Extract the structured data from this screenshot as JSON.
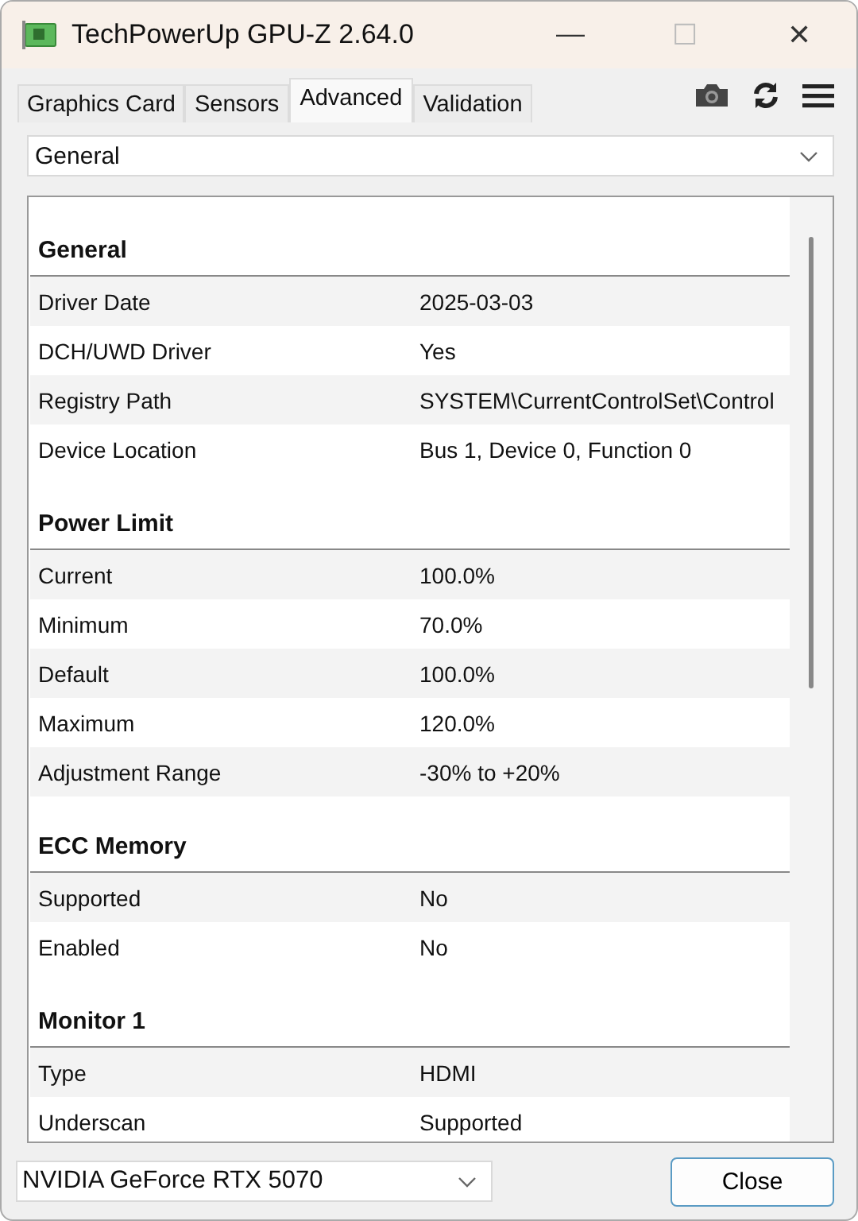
{
  "window": {
    "title": "TechPowerUp GPU-Z 2.64.0",
    "controls": [
      "—",
      "☐",
      "✕"
    ]
  },
  "tabs": [
    {
      "label": "Graphics Card",
      "selected": false
    },
    {
      "label": "Sensors",
      "selected": false
    },
    {
      "label": "Advanced",
      "selected": true
    },
    {
      "label": "Validation",
      "selected": false
    }
  ],
  "category_select": {
    "value": "General"
  },
  "sections": [
    {
      "title": "General",
      "rows": [
        {
          "label": "Driver Date",
          "value": "2025-03-03"
        },
        {
          "label": "DCH/UWD Driver",
          "value": "Yes"
        },
        {
          "label": "Registry Path",
          "value": "SYSTEM\\CurrentControlSet\\Control"
        },
        {
          "label": "Device Location",
          "value": "Bus 1, Device 0, Function 0"
        }
      ]
    },
    {
      "title": "Power Limit",
      "rows": [
        {
          "label": "Current",
          "value": "100.0%"
        },
        {
          "label": "Minimum",
          "value": "70.0%"
        },
        {
          "label": "Default",
          "value": "100.0%"
        },
        {
          "label": "Maximum",
          "value": "120.0%"
        },
        {
          "label": "Adjustment Range",
          "value": "-30% to +20%"
        }
      ]
    },
    {
      "title": "ECC Memory",
      "rows": [
        {
          "label": "Supported",
          "value": "No"
        },
        {
          "label": "Enabled",
          "value": "No"
        }
      ]
    },
    {
      "title": "Monitor 1",
      "rows": [
        {
          "label": "Type",
          "value": "HDMI"
        },
        {
          "label": "Underscan",
          "value": "Supported"
        }
      ]
    }
  ],
  "gpu_select": {
    "value": "NVIDIA GeForce RTX 5070"
  },
  "close_button": {
    "label": "Close"
  }
}
